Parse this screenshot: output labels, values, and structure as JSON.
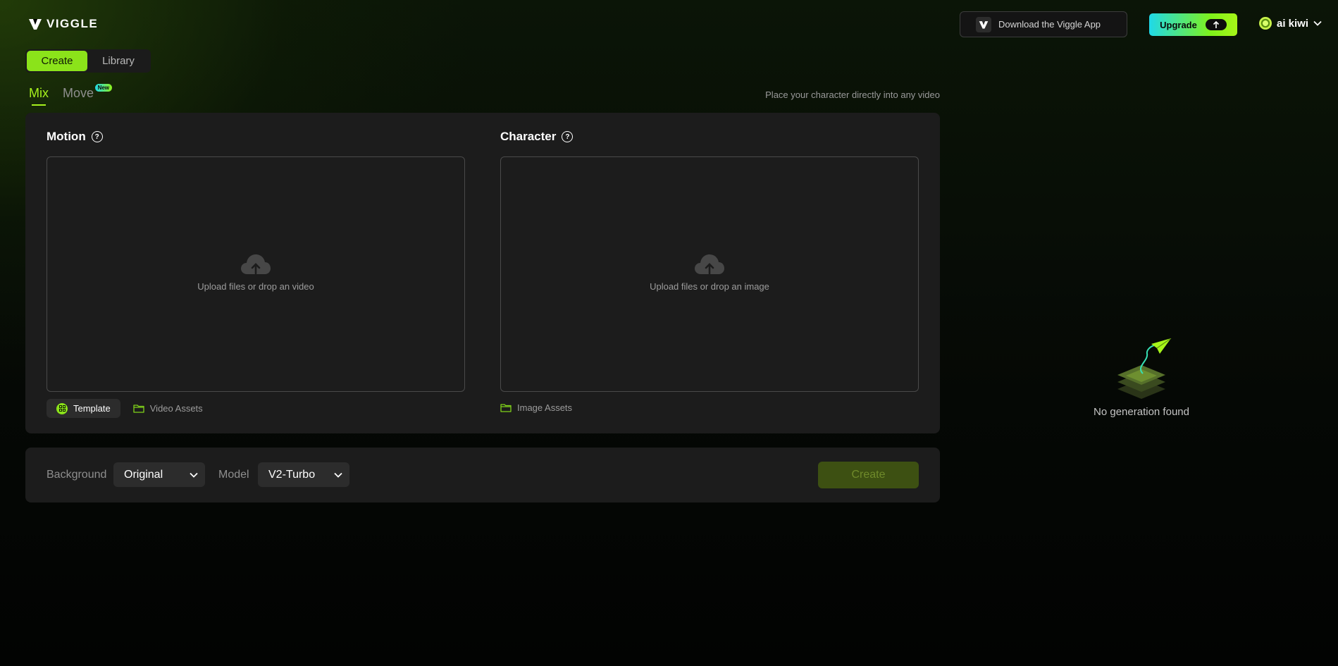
{
  "header": {
    "brand": "VIGGLE",
    "download_label": "Download the Viggle App",
    "upgrade_label": "Upgrade",
    "username": "ai kiwi"
  },
  "top_tabs": [
    {
      "label": "Create",
      "active": true
    },
    {
      "label": "Library",
      "active": false
    }
  ],
  "mode_tabs": [
    {
      "label": "Mix",
      "active": true
    },
    {
      "label": "Move",
      "active": false,
      "badge": "New"
    }
  ],
  "mode_description": "Place your character directly into any video",
  "motion": {
    "title": "Motion",
    "upload_text": "Upload files or drop an video",
    "template_label": "Template",
    "assets_label": "Video Assets"
  },
  "character": {
    "title": "Character",
    "upload_text": "Upload files or drop an image",
    "assets_label": "Image Assets"
  },
  "settings": {
    "background_label": "Background",
    "background_value": "Original",
    "model_label": "Model",
    "model_value": "V2-Turbo",
    "create_label": "Create"
  },
  "empty_state": {
    "text": "No generation found"
  },
  "colors": {
    "accent": "#8be31a",
    "accent_text": "#a7f21d",
    "panel": "#1c1c1c",
    "create_disabled": "#3d5012"
  }
}
